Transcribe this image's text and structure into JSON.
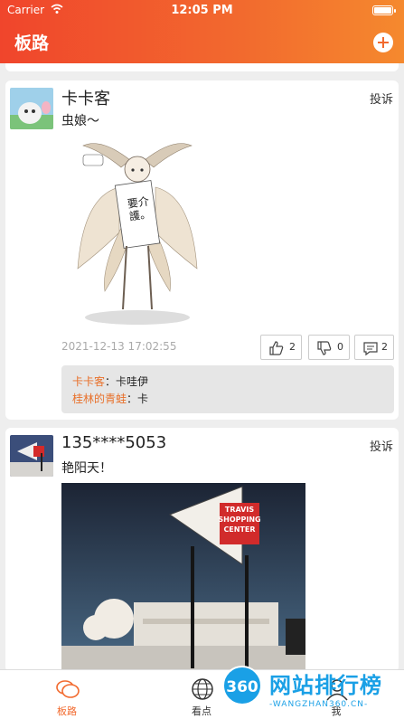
{
  "status_bar": {
    "carrier": "Carrier",
    "time": "12:05 PM",
    "battery_level": 1.0
  },
  "header": {
    "title": "板路",
    "add_icon": "plus-circle-icon"
  },
  "posts": [
    {
      "username": "卡卡客",
      "report_label": "投诉",
      "text": "虫娘～",
      "image_text": "要介護。",
      "timestamp": "2021-12-13 17:02:55",
      "likes": "2",
      "dislikes": "0",
      "comment_count": "2",
      "comments": [
        {
          "author": "卡卡客",
          "separator": "：",
          "text": "卡哇伊"
        },
        {
          "author": "桂林的青蛙",
          "separator": "：",
          "text": "卡"
        }
      ]
    },
    {
      "username": "135****5053",
      "report_label": "投诉",
      "text": "艳阳天！",
      "image_sign_lines": [
        "TRAVIS",
        "SHOPPING",
        "CENTER"
      ]
    }
  ],
  "tabbar": {
    "tabs": [
      {
        "label": "板路",
        "icon": "chat-bubbles-icon",
        "active": true
      },
      {
        "label": "看点",
        "icon": "globe-icon",
        "active": false
      },
      {
        "label": "我",
        "icon": "person-icon",
        "active": false
      }
    ]
  },
  "watermark": {
    "badge": "360",
    "main": "网站排行榜",
    "sub": "-WANGZHAN360.CN-"
  },
  "colors": {
    "accent": "#f26a2e",
    "comment_author": "#e8702a",
    "watermark": "#1aa0e6"
  }
}
